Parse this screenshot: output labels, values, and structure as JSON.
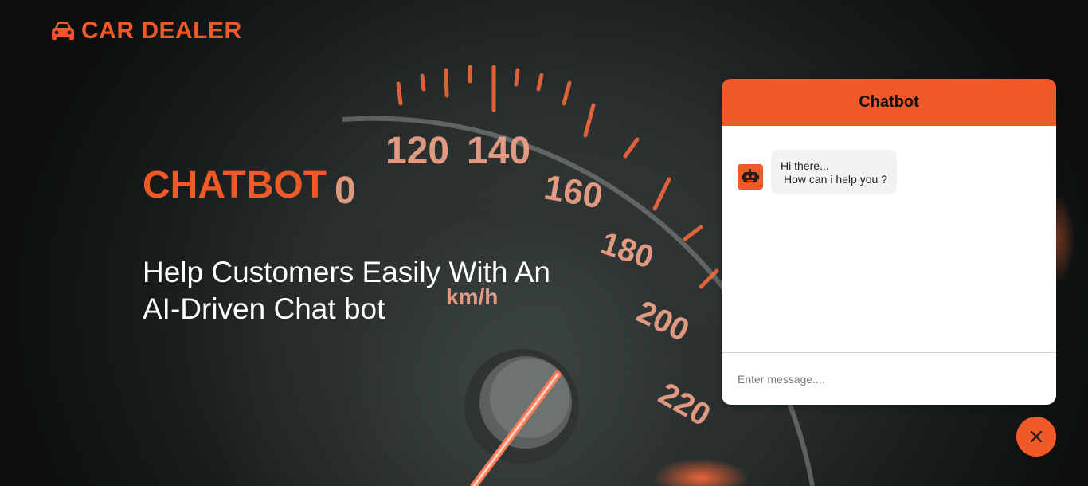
{
  "brand": {
    "logo_text": "CAR DEALER",
    "logo_icon": "car-icon",
    "accent_color": "#f05a28"
  },
  "hero": {
    "title": "CHATBOT",
    "subtitle_line1": "Help Customers Easily With An",
    "subtitle_line2": "AI-Driven Chat bot",
    "gauge_labels": [
      "120",
      "140",
      "160",
      "180",
      "200",
      "220",
      "km/h"
    ]
  },
  "chat": {
    "header_title": "Chatbot",
    "bot_icon": "robot-icon",
    "messages": [
      {
        "sender": "bot",
        "line1": "Hi there...",
        "line2": "How can i help you ?"
      }
    ],
    "input_placeholder": "Enter message....",
    "close_icon": "close-icon"
  }
}
